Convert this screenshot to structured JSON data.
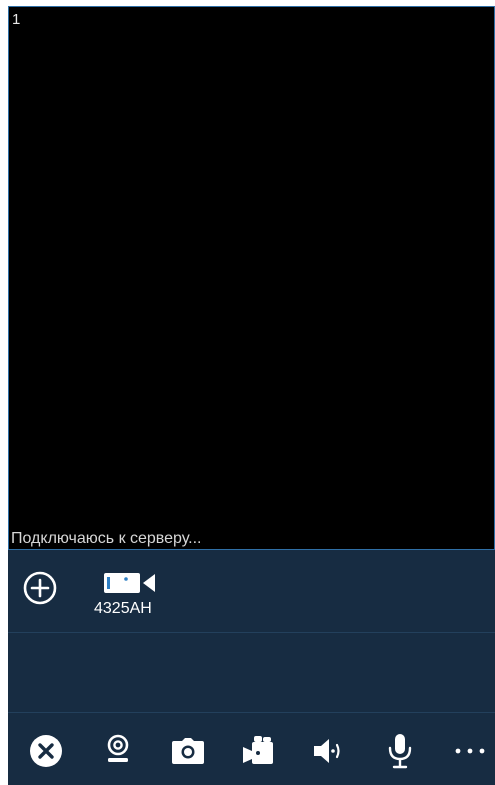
{
  "video": {
    "channel_number": "1",
    "status": "Подключаюсь к серверу..."
  },
  "devices": {
    "add_icon": "plus-circle-icon",
    "items": [
      {
        "icon": "video-camera-icon",
        "label": "4325AH"
      }
    ]
  },
  "toolbar": {
    "buttons": [
      {
        "icon": "close-circle-icon"
      },
      {
        "icon": "webcam-icon"
      },
      {
        "icon": "camera-snapshot-icon"
      },
      {
        "icon": "video-record-icon"
      },
      {
        "icon": "speaker-icon"
      },
      {
        "icon": "microphone-icon"
      },
      {
        "icon": "more-icon"
      }
    ]
  },
  "colors": {
    "panel_bg": "#172c42",
    "video_bg": "#000000",
    "video_border": "#2f6fa6",
    "icon_color": "#ffffff"
  }
}
